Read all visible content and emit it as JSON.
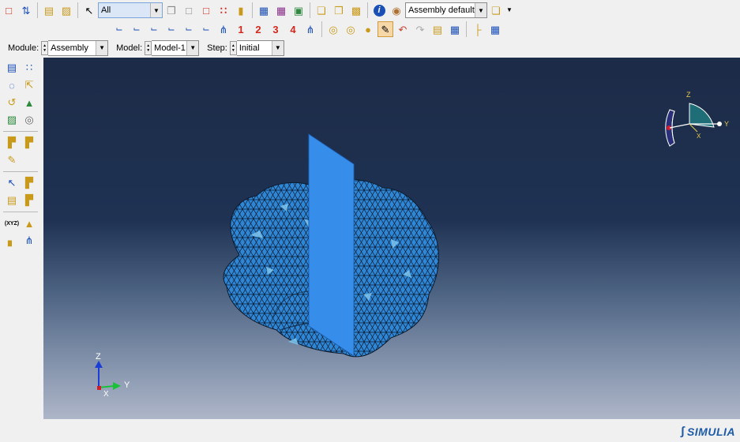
{
  "toolbar": {
    "selection_filter": "All",
    "render_style": "Assembly defaults",
    "view_numbers": [
      "1",
      "2",
      "3",
      "4"
    ]
  },
  "context_bar": {
    "module_label": "Module:",
    "module_value": "Assembly",
    "model_label": "Model:",
    "model_value": "Model-1",
    "step_label": "Step:",
    "step_value": "Initial"
  },
  "triad": {
    "z": "Z",
    "y": "Y",
    "x": "X"
  },
  "view_cube": {
    "z": "Z",
    "y": "Y",
    "x": "X"
  },
  "left_toolbox": {
    "xyz_label": "(XYZ)"
  },
  "brand": {
    "name": "SIMULIA",
    "color": "#1d5aa8"
  },
  "colors": {
    "mesh_fill": "#2e87d6",
    "mesh_highlight": "#7ec5ee",
    "plane_fill": "#3a8ff0"
  }
}
